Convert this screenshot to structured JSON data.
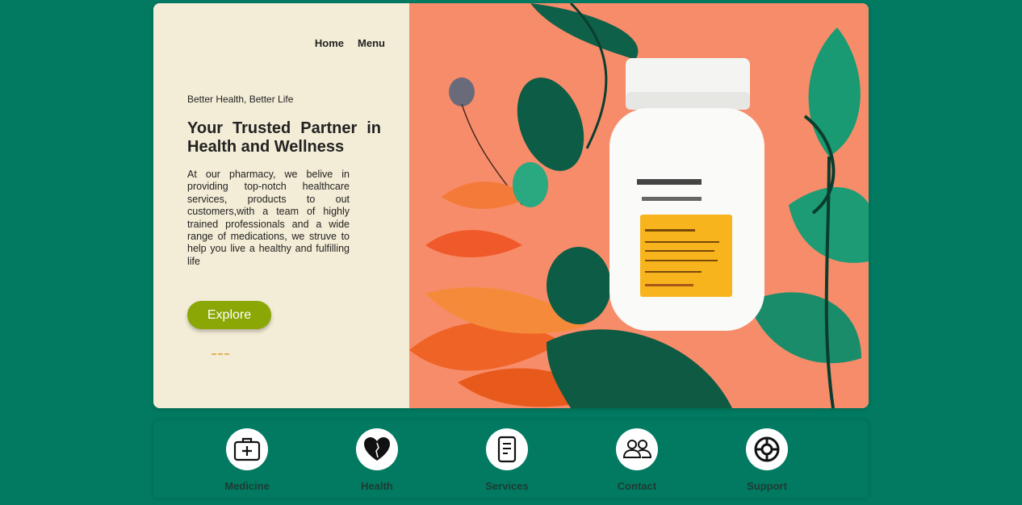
{
  "nav": {
    "home": "Home",
    "menu": "Menu"
  },
  "hero": {
    "tagline": "Better Health, Better Life",
    "title": "Your Trusted Partner in Health and Wellness",
    "description": "At our pharmacy, we belive in providing top-notch healthcare services, products to out customers,with a team of highly trained professionals and a wide range of medications, we struve to help you live a healthy and fulfilling life",
    "button": "Explore"
  },
  "features": [
    {
      "label": "Medicine",
      "icon": "medical-kit-icon"
    },
    {
      "label": "Health",
      "icon": "heart-icon"
    },
    {
      "label": "Services",
      "icon": "document-icon"
    },
    {
      "label": "Contact",
      "icon": "people-icon"
    },
    {
      "label": "Support",
      "icon": "lifebuoy-icon"
    }
  ],
  "colors": {
    "background": "#017a61",
    "hero_left": "#f3ecd6",
    "hero_right": "#f78c6a",
    "button": "#8aa706",
    "bottle_label": "#f7b41d"
  }
}
